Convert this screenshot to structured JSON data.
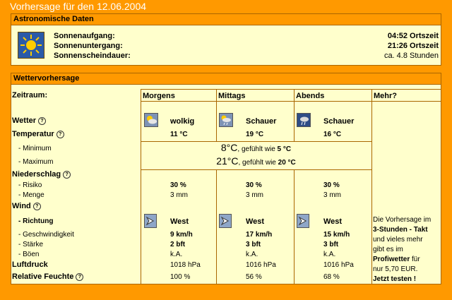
{
  "title": "Vorhersage für den 12.06.2004",
  "astro": {
    "header": "Astronomische Daten",
    "rows": [
      {
        "label": "Sonnenaufgang:",
        "value": "04:52 Ortszeit"
      },
      {
        "label": "Sonnenuntergang:",
        "value": "21:26 Ortszeit"
      },
      {
        "label": "Sonnenscheindauer:",
        "value": "ca. 4.8 Stunden"
      }
    ]
  },
  "wx": {
    "header": "Wettervorhersage",
    "zeitraum": "Zeitraum:",
    "cols": [
      "Morgens",
      "Mittags",
      "Abends",
      "Mehr?"
    ],
    "wetter_label": "Wetter",
    "wetter": [
      "wolkig",
      "Schauer",
      "Schauer"
    ],
    "temp_label": "Temperatur",
    "temp": [
      "11 °C",
      "19 °C",
      "16 °C"
    ],
    "min_label": "- Minimum",
    "min_val": "8°C",
    "min_feel": ", gefühlt wie",
    "min_feel_val": "5 °C",
    "max_label": "- Maximum",
    "max_val": "21°C",
    "max_feel": ", gefühlt wie",
    "max_feel_val": "20 °C",
    "niederschlag_label": "Niederschlag",
    "risiko_label": "- Risiko",
    "risiko": [
      "30 %",
      "30 %",
      "30 %"
    ],
    "menge_label": "- Menge",
    "menge": [
      "3 mm",
      "3 mm",
      "3 mm"
    ],
    "wind_label": "Wind",
    "richtung_label": "- Richtung",
    "richtung": [
      "West",
      "West",
      "West"
    ],
    "geschw_label": "- Geschwindigkeit",
    "geschw": [
      "9 km/h",
      "17 km/h",
      "15 km/h"
    ],
    "staerke_label": "- Stärke",
    "staerke": [
      "2 bft",
      "3 bft",
      "3 bft"
    ],
    "boeen_label": "- Böen",
    "boeen": [
      "k.A.",
      "k.A.",
      "k.A."
    ],
    "druck_label": "Luftdruck",
    "druck": [
      "1018 hPa",
      "1016 hPa",
      "1016 hPa"
    ],
    "feuchte_label": "Relative Feuchte",
    "feuchte": [
      "100 %",
      "56 %",
      "68 %"
    ],
    "promo": {
      "l1": "Die Vorhersage im",
      "l2": "3-Stunden - Takt",
      "l3": "und vieles mehr",
      "l4": "gibt es im",
      "l5a": "Profiwetter",
      "l5b": " für",
      "l6": "nur 5,70 EUR.",
      "l7": "Jetzt testen !"
    },
    "help_glyph": "?"
  }
}
